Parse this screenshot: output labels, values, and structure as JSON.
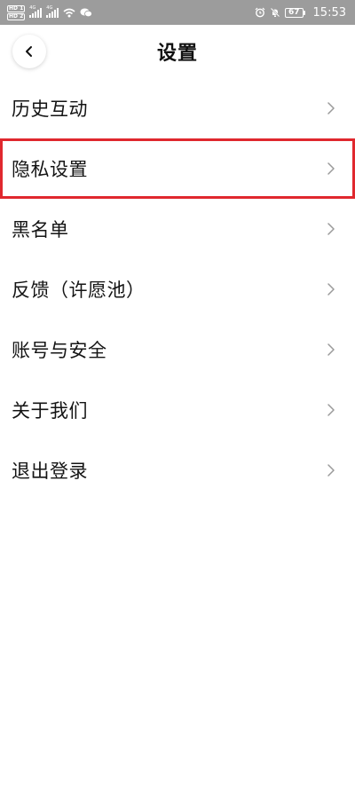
{
  "status_bar": {
    "hd1": "HD 1",
    "hd2": "HD 2",
    "net1": "4G",
    "net2": "4G",
    "battery": "67",
    "time": "15:53"
  },
  "header": {
    "title": "设置"
  },
  "menu": {
    "items": [
      {
        "label": "历史互动"
      },
      {
        "label": "隐私设置"
      },
      {
        "label": "黑名单"
      },
      {
        "label": "反馈（许愿池）"
      },
      {
        "label": "账号与安全"
      },
      {
        "label": "关于我们"
      },
      {
        "label": "退出登录"
      }
    ]
  },
  "colors": {
    "status_bar_bg": "#9c9c9c",
    "highlight_border": "#e0282e",
    "chevron": "#9a9a9a"
  },
  "icons": {
    "back": "chevron-left-icon",
    "row_arrow": "chevron-right-icon"
  }
}
